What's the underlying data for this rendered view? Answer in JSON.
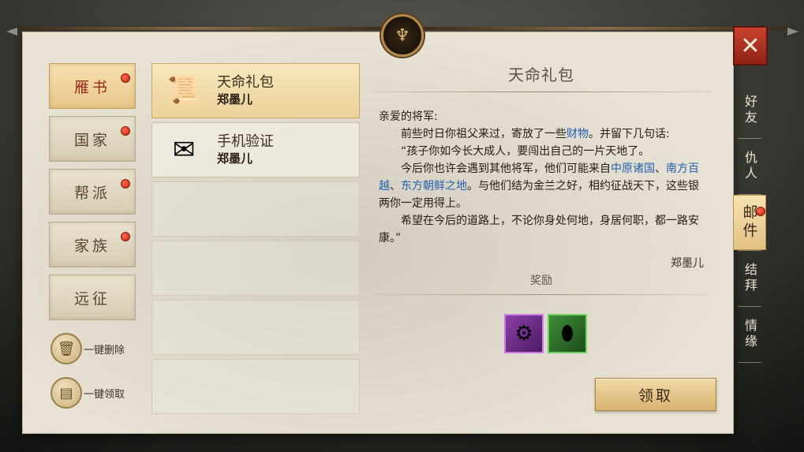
{
  "left_nav": [
    {
      "label": "雁书",
      "active": true,
      "badge": true
    },
    {
      "label": "国家",
      "active": false,
      "badge": true
    },
    {
      "label": "帮派",
      "active": false,
      "badge": true
    },
    {
      "label": "家族",
      "active": false,
      "badge": true
    },
    {
      "label": "远征",
      "active": false,
      "badge": false
    }
  ],
  "actions": {
    "delete_all": {
      "label": "一键删除",
      "icon": "trash-icon"
    },
    "claim_all": {
      "label": "一键领取",
      "icon": "box-icon"
    }
  },
  "mail_list": [
    {
      "title": "天命礼包",
      "sender": "郑墨儿",
      "icon": "scroll-icon",
      "active": true
    },
    {
      "title": "手机验证",
      "sender": "郑墨儿",
      "icon": "letter-check-icon",
      "active": false
    }
  ],
  "detail": {
    "title": "天命礼包",
    "greeting": "亲爱的将军:",
    "para1_a": "前些时日你祖父来过，寄放了一些",
    "para1_hl": "财物",
    "para1_b": "。并留下几句话:",
    "para2": "“孩子你如今长大成人，要闯出自己的一片天地了。",
    "para3_a": "今后你也许会遇到其他将军，他们可能来自",
    "para3_hl1": "中原诸国",
    "para3_sep1": "、",
    "para3_hl2": "南方百越",
    "para3_sep2": "、",
    "para3_hl3": "东方朝鲜之地",
    "para3_b": "。与他们结为金兰之好，相约征战天下，这些银两你一定用得上。",
    "para4": "希望在今后的道路上，不论你身处何地，身居何职，都一路安康。”",
    "signature": "郑墨儿",
    "reward_label": "奖励",
    "rewards": [
      {
        "name": "purple-item",
        "icon": "box-icon",
        "rarity": "purple"
      },
      {
        "name": "green-item",
        "icon": "pouch-icon",
        "rarity": "green"
      }
    ],
    "claim_label": "领取"
  },
  "right_tabs": [
    {
      "label": "好友",
      "active": false,
      "badge": false
    },
    {
      "label": "仇人",
      "active": false,
      "badge": false
    },
    {
      "label": "邮件",
      "active": true,
      "badge": true
    },
    {
      "label": "结拜",
      "active": false,
      "badge": false
    },
    {
      "label": "情缘",
      "active": false,
      "badge": false
    }
  ],
  "colors": {
    "highlight": "#1f5fb0",
    "badge": "#c1240f",
    "active_tab": "#e7c68a"
  }
}
